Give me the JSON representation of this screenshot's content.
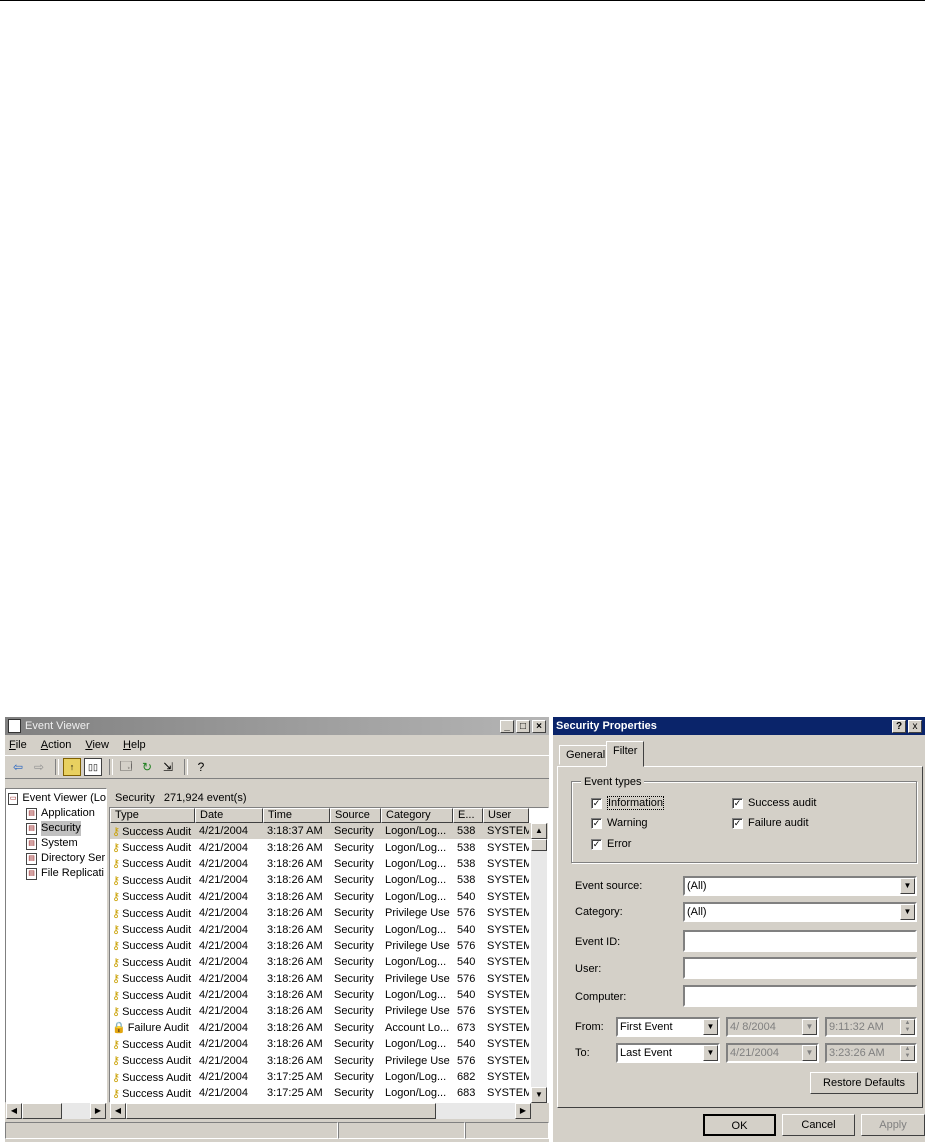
{
  "event_viewer": {
    "title": "Event Viewer",
    "menu": [
      "File",
      "Action",
      "View",
      "Help"
    ],
    "tree": {
      "root": "Event Viewer (Lo",
      "items": [
        "Application",
        "Security",
        "System",
        "Directory Ser",
        "File Replicati"
      ]
    },
    "list_header": {
      "log": "Security",
      "count": "271,924 event(s)"
    },
    "columns": [
      "Type",
      "Date",
      "Time",
      "Source",
      "Category",
      "E...",
      "User"
    ],
    "rows": [
      {
        "type": "Success Audit",
        "date": "4/21/2004",
        "time": "3:18:37 AM",
        "source": "Security",
        "category": "Logon/Log...",
        "event": "538",
        "user": "SYSTEM",
        "icon": "key-icon"
      },
      {
        "type": "Success Audit",
        "date": "4/21/2004",
        "time": "3:18:26 AM",
        "source": "Security",
        "category": "Logon/Log...",
        "event": "538",
        "user": "SYSTEM",
        "icon": "key-icon"
      },
      {
        "type": "Success Audit",
        "date": "4/21/2004",
        "time": "3:18:26 AM",
        "source": "Security",
        "category": "Logon/Log...",
        "event": "538",
        "user": "SYSTEM",
        "icon": "key-icon"
      },
      {
        "type": "Success Audit",
        "date": "4/21/2004",
        "time": "3:18:26 AM",
        "source": "Security",
        "category": "Logon/Log...",
        "event": "538",
        "user": "SYSTEM",
        "icon": "key-icon"
      },
      {
        "type": "Success Audit",
        "date": "4/21/2004",
        "time": "3:18:26 AM",
        "source": "Security",
        "category": "Logon/Log...",
        "event": "540",
        "user": "SYSTEM",
        "icon": "key-icon"
      },
      {
        "type": "Success Audit",
        "date": "4/21/2004",
        "time": "3:18:26 AM",
        "source": "Security",
        "category": "Privilege Use",
        "event": "576",
        "user": "SYSTEM",
        "icon": "key-icon"
      },
      {
        "type": "Success Audit",
        "date": "4/21/2004",
        "time": "3:18:26 AM",
        "source": "Security",
        "category": "Logon/Log...",
        "event": "540",
        "user": "SYSTEM",
        "icon": "key-icon"
      },
      {
        "type": "Success Audit",
        "date": "4/21/2004",
        "time": "3:18:26 AM",
        "source": "Security",
        "category": "Privilege Use",
        "event": "576",
        "user": "SYSTEM",
        "icon": "key-icon"
      },
      {
        "type": "Success Audit",
        "date": "4/21/2004",
        "time": "3:18:26 AM",
        "source": "Security",
        "category": "Logon/Log...",
        "event": "540",
        "user": "SYSTEM",
        "icon": "key-icon"
      },
      {
        "type": "Success Audit",
        "date": "4/21/2004",
        "time": "3:18:26 AM",
        "source": "Security",
        "category": "Privilege Use",
        "event": "576",
        "user": "SYSTEM",
        "icon": "key-icon"
      },
      {
        "type": "Success Audit",
        "date": "4/21/2004",
        "time": "3:18:26 AM",
        "source": "Security",
        "category": "Logon/Log...",
        "event": "540",
        "user": "SYSTEM",
        "icon": "key-icon"
      },
      {
        "type": "Success Audit",
        "date": "4/21/2004",
        "time": "3:18:26 AM",
        "source": "Security",
        "category": "Privilege Use",
        "event": "576",
        "user": "SYSTEM",
        "icon": "key-icon"
      },
      {
        "type": "Failure Audit",
        "date": "4/21/2004",
        "time": "3:18:26 AM",
        "source": "Security",
        "category": "Account Lo...",
        "event": "673",
        "user": "SYSTEM",
        "icon": "lock-icon"
      },
      {
        "type": "Success Audit",
        "date": "4/21/2004",
        "time": "3:18:26 AM",
        "source": "Security",
        "category": "Logon/Log...",
        "event": "540",
        "user": "SYSTEM",
        "icon": "key-icon"
      },
      {
        "type": "Success Audit",
        "date": "4/21/2004",
        "time": "3:18:26 AM",
        "source": "Security",
        "category": "Privilege Use",
        "event": "576",
        "user": "SYSTEM",
        "icon": "key-icon"
      },
      {
        "type": "Success Audit",
        "date": "4/21/2004",
        "time": "3:17:25 AM",
        "source": "Security",
        "category": "Logon/Log...",
        "event": "682",
        "user": "SYSTEM",
        "icon": "key-icon"
      },
      {
        "type": "Success Audit",
        "date": "4/21/2004",
        "time": "3:17:25 AM",
        "source": "Security",
        "category": "Logon/Log...",
        "event": "683",
        "user": "SYSTEM",
        "icon": "key-icon"
      }
    ]
  },
  "security_properties": {
    "title": "Security Properties",
    "help_btn": "?",
    "close_btn": "x",
    "tabs": [
      "General",
      "Filter"
    ],
    "group_title": "Event types",
    "checkboxes": {
      "information": "Information",
      "warning": "Warning",
      "error": "Error",
      "success_audit": "Success audit",
      "failure_audit": "Failure audit"
    },
    "labels": {
      "event_source": "Event source:",
      "category": "Category:",
      "event_id": "Event ID:",
      "user": "User:",
      "computer": "Computer:",
      "from": "From:",
      "to": "To:"
    },
    "values": {
      "event_source": "(All)",
      "category": "(All)",
      "event_id": "",
      "user": "",
      "computer": "",
      "from_type": "First Event",
      "from_date": "4/ 8/2004",
      "from_time": "9:11:32 AM",
      "to_type": "Last Event",
      "to_date": "4/21/2004",
      "to_time": "3:23:26 AM"
    },
    "buttons": {
      "restore": "Restore Defaults",
      "ok": "OK",
      "cancel": "Cancel",
      "apply": "Apply"
    }
  }
}
